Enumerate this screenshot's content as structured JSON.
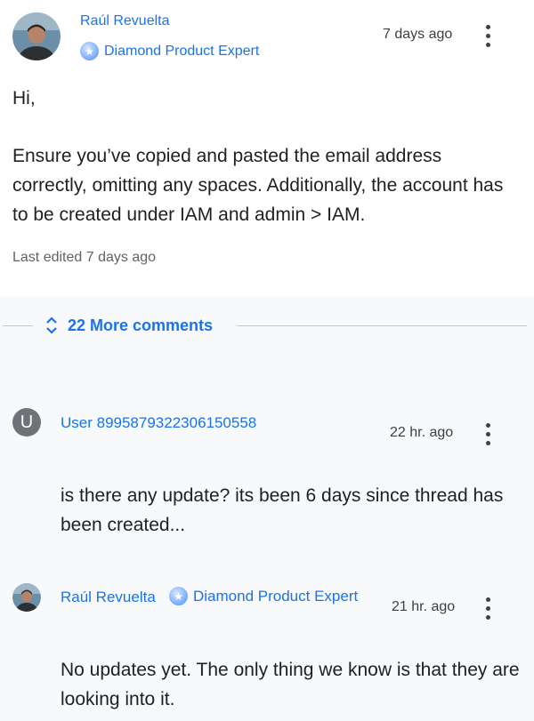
{
  "post": {
    "author": "Raúl Revuelta",
    "badge": "Diamond Product Expert",
    "time": "7 days ago",
    "greeting": "Hi,",
    "body": "Ensure you’ve copied and pasted the email address correctly, omitting any spaces. Additionally, the account has to be created under IAM and admin > IAM.",
    "edited": "Last edited 7 days ago"
  },
  "more_comments": {
    "label": "22 More comments",
    "icon": "unfold-more-icon"
  },
  "comments": [
    {
      "avatar_letter": "U",
      "author": "User 8995879322306150558",
      "time": "22 hr. ago",
      "text": "is there any update? its been 6 days since thread has been created..."
    },
    {
      "author": "Raúl Revuelta",
      "badge": "Diamond Product Expert",
      "time": "21 hr. ago",
      "text": "No updates yet. The only thing we know is that they are looking into it."
    }
  ],
  "colors": {
    "link": "#1a73e8",
    "page_bg": "#f8f9fa",
    "post_bg": "#ffffff",
    "text": "#202124",
    "muted": "#5f6368"
  }
}
